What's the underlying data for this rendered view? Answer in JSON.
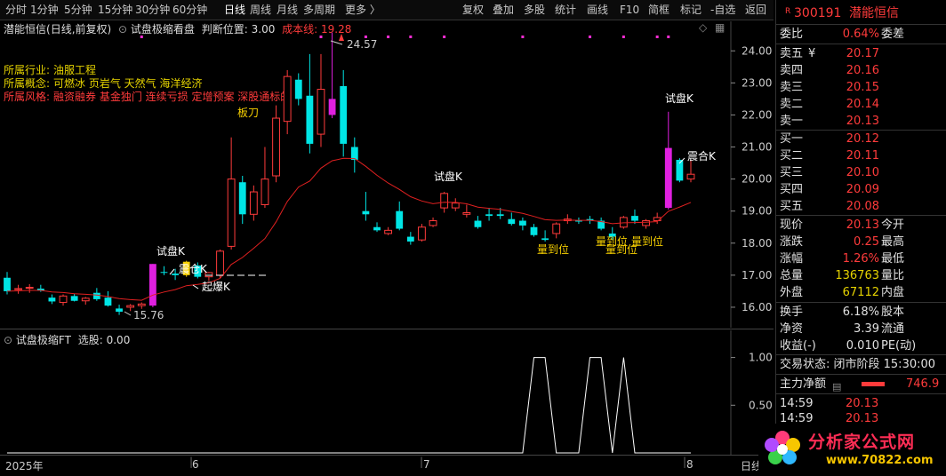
{
  "toolbar": {
    "left_items": [
      "分时",
      "1分钟",
      "5分钟",
      "15分钟",
      "30分钟",
      "60分钟",
      "日线",
      "周线",
      "月线",
      "多周期",
      "更多"
    ],
    "active": "日线",
    "right_items": [
      "复权",
      "叠加",
      "多股",
      "统计",
      "画线",
      "F10",
      "简框",
      "标记",
      "-自选",
      "返回"
    ]
  },
  "main": {
    "stock": "潜能恒信",
    "mode": "(日线,前复权)",
    "indicator": "试盘极缩看盘",
    "judge_label": "判断位置: 3.00",
    "cost_label": "成本线: 19.28",
    "info": {
      "industry_label": "所属行业:",
      "industry_value": "油服工程",
      "concept_label": "所属概念:",
      "concept_value": "可燃冰 页岩气 天然气 海洋经济",
      "style_label": "所属风格:",
      "style_value": "融资融券 基金独门 连续亏损 定增预案 深股通标的"
    },
    "annotations": {
      "high": "24.57",
      "low": "15.76",
      "bandao": "板刀",
      "shipan1": "试盘K",
      "zhencang1": "震仓K",
      "qibao": "起爆K",
      "shipan2": "试盘K",
      "shipan3": "试盘K",
      "zhenhe": "震合K",
      "liang1": "量到位",
      "liang2": "量到位",
      "liang3": "量到位",
      "liang4": "量到位"
    }
  },
  "sub": {
    "title": "试盘极缩FT",
    "select": "选股: 0.00"
  },
  "xaxis": {
    "year": "2025年",
    "months": [
      "6",
      "7",
      "8"
    ],
    "corner": "日线"
  },
  "chart_data": [
    {
      "type": "candlestick",
      "title": "试盘极缩看盘",
      "yticks": [
        16.0,
        17.0,
        18.0,
        19.0,
        20.0,
        21.0,
        22.0,
        23.0,
        24.0
      ],
      "ylim": [
        15.5,
        24.7
      ],
      "candles": [
        [
          16.92,
          17.1,
          16.4,
          16.5
        ],
        [
          16.55,
          16.7,
          16.42,
          16.58
        ],
        [
          16.6,
          16.72,
          16.45,
          16.62
        ],
        [
          16.58,
          16.7,
          16.48,
          16.52
        ],
        [
          16.3,
          16.4,
          16.1,
          16.18
        ],
        [
          16.15,
          16.4,
          16.05,
          16.35
        ],
        [
          16.35,
          16.42,
          16.18,
          16.2
        ],
        [
          16.2,
          16.32,
          16.08,
          16.28
        ],
        [
          16.45,
          16.6,
          16.2,
          16.25
        ],
        [
          16.3,
          16.5,
          16.02,
          16.05
        ],
        [
          15.96,
          16.08,
          15.76,
          15.86
        ],
        [
          16.0,
          16.1,
          15.88,
          16.05
        ],
        [
          16.05,
          16.15,
          15.95,
          16.1
        ],
        [
          16.05,
          17.35,
          16.0,
          17.35
        ],
        [
          17.1,
          17.28,
          17.0,
          17.08
        ],
        [
          17.05,
          17.2,
          16.85,
          17.0
        ],
        [
          17.0,
          17.45,
          16.95,
          17.42
        ],
        [
          17.3,
          17.4,
          16.9,
          16.95
        ],
        [
          16.95,
          17.1,
          16.82,
          17.08
        ],
        [
          17.0,
          17.8,
          16.9,
          17.75
        ],
        [
          17.9,
          21.3,
          17.8,
          20.0
        ],
        [
          19.9,
          20.1,
          18.6,
          18.9
        ],
        [
          18.9,
          19.8,
          18.7,
          19.6
        ],
        [
          19.2,
          21.0,
          19.1,
          20.0
        ],
        [
          20.1,
          22.3,
          19.9,
          21.9
        ],
        [
          21.8,
          23.4,
          21.4,
          23.2
        ],
        [
          23.1,
          23.3,
          22.3,
          22.5
        ],
        [
          22.6,
          23.9,
          20.8,
          21.1
        ],
        [
          21.4,
          23.9,
          21.0,
          22.8
        ],
        [
          22.5,
          24.57,
          21.9,
          22.0
        ],
        [
          22.9,
          23.4,
          20.7,
          21.1
        ],
        [
          21.0,
          21.3,
          20.2,
          20.6
        ],
        [
          19.0,
          19.6,
          18.7,
          18.9
        ],
        [
          18.5,
          18.65,
          18.35,
          18.4
        ],
        [
          18.3,
          18.5,
          18.25,
          18.4
        ],
        [
          19.0,
          19.3,
          18.4,
          18.45
        ],
        [
          18.2,
          18.35,
          17.95,
          18.05
        ],
        [
          18.1,
          18.6,
          18.05,
          18.5
        ],
        [
          18.55,
          18.8,
          18.5,
          18.7
        ],
        [
          19.1,
          19.6,
          18.95,
          19.55
        ],
        [
          19.1,
          19.4,
          19.0,
          19.25
        ],
        [
          18.9,
          19.2,
          18.8,
          18.95
        ],
        [
          18.7,
          18.85,
          18.45,
          18.5
        ],
        [
          18.9,
          19.1,
          18.7,
          18.85
        ],
        [
          18.9,
          19.1,
          18.75,
          18.85
        ],
        [
          18.75,
          18.95,
          18.55,
          18.6
        ],
        [
          18.7,
          18.8,
          18.4,
          18.55
        ],
        [
          18.5,
          18.6,
          18.2,
          18.25
        ],
        [
          18.15,
          18.4,
          18.05,
          18.1
        ],
        [
          18.3,
          18.65,
          18.15,
          18.6
        ],
        [
          18.7,
          18.9,
          18.6,
          18.75
        ],
        [
          18.7,
          18.8,
          18.6,
          18.68
        ],
        [
          18.75,
          18.85,
          18.6,
          18.7
        ],
        [
          18.7,
          18.8,
          18.4,
          18.45
        ],
        [
          18.3,
          18.5,
          18.1,
          18.2
        ],
        [
          18.5,
          18.85,
          18.45,
          18.8
        ],
        [
          18.85,
          19.05,
          18.6,
          18.7
        ],
        [
          18.55,
          18.75,
          18.45,
          18.7
        ],
        [
          18.7,
          18.95,
          18.6,
          18.8
        ],
        [
          19.1,
          22.1,
          19.05,
          20.97
        ],
        [
          20.6,
          20.65,
          19.9,
          19.95
        ],
        [
          20.0,
          20.6,
          19.9,
          20.15
        ]
      ]
    },
    {
      "type": "line",
      "title": "试盘极缩FT",
      "yticks": [
        0.0,
        0.5,
        1.0
      ],
      "ylim": [
        0,
        1.08
      ],
      "x": [
        0,
        1,
        2,
        3,
        4,
        5,
        6,
        7,
        8,
        9,
        10,
        11,
        12,
        13,
        14,
        15,
        16,
        17,
        18,
        19,
        20,
        21,
        22,
        23,
        24,
        25,
        26,
        27,
        28,
        29,
        30,
        31,
        32,
        33,
        34,
        35,
        36,
        37,
        38,
        39,
        40,
        41,
        42,
        43,
        44,
        45,
        46,
        47,
        48,
        49,
        50,
        51,
        52,
        53,
        54,
        55,
        56,
        57,
        58,
        59,
        60,
        61
      ],
      "values": [
        0,
        0,
        0,
        0,
        0,
        0,
        0,
        0,
        0,
        0,
        0,
        0,
        0,
        0,
        0,
        0,
        0,
        0,
        0,
        0,
        0,
        0,
        0,
        0,
        0,
        0,
        0,
        0,
        0,
        0,
        0,
        0,
        0,
        0,
        0,
        0,
        0,
        0,
        0,
        0,
        0,
        0,
        0,
        0,
        0,
        0,
        0,
        1,
        1,
        0,
        0,
        0,
        1,
        1,
        0,
        1,
        0,
        0,
        0,
        0,
        0,
        0
      ]
    }
  ],
  "rightpanel": {
    "code": "300191",
    "name": "潜能恒信",
    "weibi_label": "委比",
    "weibi_value": "0.64%",
    "weicha_label": "委差",
    "sell": [
      {
        "label": "卖五",
        "price": "20.17",
        "mark": "¥"
      },
      {
        "label": "卖四",
        "price": "20.16"
      },
      {
        "label": "卖三",
        "price": "20.15"
      },
      {
        "label": "卖二",
        "price": "20.14"
      },
      {
        "label": "卖一",
        "price": "20.13"
      }
    ],
    "buy": [
      {
        "label": "买一",
        "price": "20.12"
      },
      {
        "label": "买二",
        "price": "20.11"
      },
      {
        "label": "买三",
        "price": "20.10"
      },
      {
        "label": "买四",
        "price": "20.09"
      },
      {
        "label": "买五",
        "price": "20.08"
      }
    ],
    "stats": [
      {
        "l": "现价",
        "v": "20.13",
        "r": "今开"
      },
      {
        "l": "涨跌",
        "v": "0.25",
        "r": "最高"
      },
      {
        "l": "涨幅",
        "v": "1.26%",
        "r": "最低"
      },
      {
        "l": "总量",
        "v": "136763",
        "r": "量比"
      },
      {
        "l": "外盘",
        "v": "67112",
        "r": "内盘"
      }
    ],
    "stats2": [
      {
        "l": "换手",
        "v": "6.18%",
        "r": "股本"
      },
      {
        "l": "净资",
        "v": "3.39",
        "r": "流通"
      },
      {
        "l": "收益(-)",
        "v": "0.010",
        "r": "PE(动)"
      }
    ],
    "trade_state": "交易状态: 闭市阶段 15:30:00",
    "zljx_label": "主力净额",
    "zljx_value": "746.9",
    "ticks": [
      {
        "time": "14:59",
        "price": "20.13"
      },
      {
        "time": "14:59",
        "price": "20.13"
      }
    ],
    "logo_text": "分析家公式网",
    "logo_url": "www.70822.com"
  }
}
